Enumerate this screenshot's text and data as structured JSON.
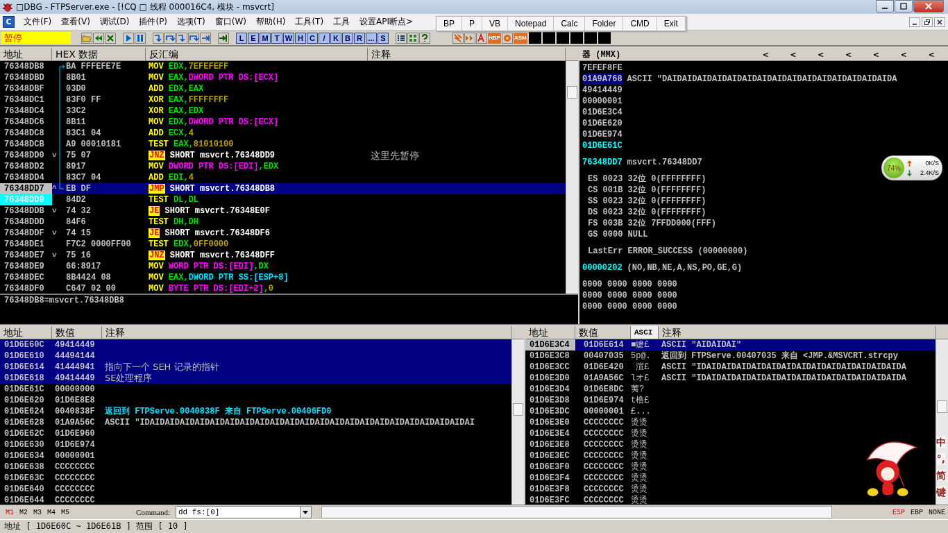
{
  "window": {
    "title": "□DBG - FTPServer.exe - [!CQ □ 线程  000016C4, 模块 - msvcrt]"
  },
  "menu": {
    "app_icon_letter": "C",
    "items": [
      "文件(F)",
      "查看(V)",
      "调试(D)",
      "插件(P)",
      "选项(T)",
      "窗口(W)",
      "帮助(H)",
      "工具(T)",
      "工具",
      "设置API断点>"
    ]
  },
  "quick_toolbar": [
    "BP",
    "P",
    "VB",
    "Notepad",
    "Calc",
    "Folder",
    "CMD",
    "Exit"
  ],
  "toolbar": {
    "status": "暂停",
    "letter_buttons": [
      "L",
      "E",
      "M",
      "T",
      "W",
      "H",
      "C",
      "/",
      "K",
      "B",
      "R",
      "...",
      "S"
    ],
    "plugin_labels": [
      "HBP",
      "ASM"
    ]
  },
  "disasm": {
    "columns": [
      "地址",
      "HEX 数据",
      "反汇编",
      "注释"
    ],
    "rows": [
      {
        "address": "76348DB8",
        "mark": "",
        "hex": "BA FFFEFE7E",
        "mnemonic": "MOV",
        "jump": false,
        "operands": [
          {
            "kind": "reg",
            "text": "EDX"
          },
          {
            "kind": "sep",
            "text": ","
          },
          {
            "kind": "imm",
            "text": "7EFEFEFF"
          }
        ],
        "comment": "",
        "in_loop": true,
        "selected": false,
        "current": false
      },
      {
        "address": "76348DBD",
        "mark": "",
        "hex": "8B01",
        "mnemonic": "MOV",
        "jump": false,
        "operands": [
          {
            "kind": "reg",
            "text": "EAX"
          },
          {
            "kind": "sep",
            "text": ","
          },
          {
            "kind": "mem",
            "text": "DWORD PTR DS:[ECX]"
          }
        ],
        "comment": "",
        "in_loop": true,
        "selected": false,
        "current": false
      },
      {
        "address": "76348DBF",
        "mark": "",
        "hex": "03D0",
        "mnemonic": "ADD",
        "jump": false,
        "operands": [
          {
            "kind": "reg",
            "text": "EDX"
          },
          {
            "kind": "sep",
            "text": ","
          },
          {
            "kind": "reg",
            "text": "EAX"
          }
        ],
        "comment": "",
        "in_loop": true,
        "selected": false,
        "current": false
      },
      {
        "address": "76348DC1",
        "mark": "",
        "hex": "83F0 FF",
        "mnemonic": "XOR",
        "jump": false,
        "operands": [
          {
            "kind": "reg",
            "text": "EAX"
          },
          {
            "kind": "sep",
            "text": ","
          },
          {
            "kind": "imm",
            "text": "FFFFFFFF"
          }
        ],
        "comment": "",
        "in_loop": true,
        "selected": false,
        "current": false
      },
      {
        "address": "76348DC4",
        "mark": "",
        "hex": "33C2",
        "mnemonic": "XOR",
        "jump": false,
        "operands": [
          {
            "kind": "reg",
            "text": "EAX"
          },
          {
            "kind": "sep",
            "text": ","
          },
          {
            "kind": "reg",
            "text": "EDX"
          }
        ],
        "comment": "",
        "in_loop": true,
        "selected": false,
        "current": false
      },
      {
        "address": "76348DC6",
        "mark": "",
        "hex": "8B11",
        "mnemonic": "MOV",
        "jump": false,
        "operands": [
          {
            "kind": "reg",
            "text": "EDX"
          },
          {
            "kind": "sep",
            "text": ","
          },
          {
            "kind": "mem",
            "text": "DWORD PTR DS:[ECX]"
          }
        ],
        "comment": "",
        "in_loop": true,
        "selected": false,
        "current": false
      },
      {
        "address": "76348DC8",
        "mark": "",
        "hex": "83C1 04",
        "mnemonic": "ADD",
        "jump": false,
        "operands": [
          {
            "kind": "reg",
            "text": "ECX"
          },
          {
            "kind": "sep",
            "text": ","
          },
          {
            "kind": "imm",
            "text": "4"
          }
        ],
        "comment": "",
        "in_loop": true,
        "selected": false,
        "current": false
      },
      {
        "address": "76348DCB",
        "mark": "",
        "hex": "A9 00010181",
        "mnemonic": "TEST",
        "jump": false,
        "operands": [
          {
            "kind": "reg",
            "text": "EAX"
          },
          {
            "kind": "sep",
            "text": ","
          },
          {
            "kind": "imm",
            "text": "81010100"
          }
        ],
        "comment": "",
        "in_loop": true,
        "selected": false,
        "current": false
      },
      {
        "address": "76348DD0",
        "mark": "˅",
        "hex": "75 07",
        "mnemonic": "JNZ",
        "jump": true,
        "operands": [
          {
            "kind": "plain",
            "text": "SHORT msvcrt.76348DD9"
          }
        ],
        "comment": "这里先暂停",
        "in_loop": true,
        "selected": false,
        "current": false
      },
      {
        "address": "76348DD2",
        "mark": "",
        "hex": "8917",
        "mnemonic": "MOV",
        "jump": false,
        "operands": [
          {
            "kind": "mem",
            "text": "DWORD PTR DS:[EDI]"
          },
          {
            "kind": "sep",
            "text": ","
          },
          {
            "kind": "reg",
            "text": "EDX"
          }
        ],
        "comment": "",
        "in_loop": true,
        "selected": false,
        "current": false
      },
      {
        "address": "76348DD4",
        "mark": "",
        "hex": "83C7 04",
        "mnemonic": "ADD",
        "jump": false,
        "operands": [
          {
            "kind": "reg",
            "text": "EDI"
          },
          {
            "kind": "sep",
            "text": ","
          },
          {
            "kind": "imm",
            "text": "4"
          }
        ],
        "comment": "",
        "in_loop": true,
        "selected": false,
        "current": false
      },
      {
        "address": "76348DD7",
        "mark": "^",
        "hex": "EB DF",
        "mnemonic": "JMP",
        "jump": true,
        "operands": [
          {
            "kind": "plain",
            "text": "SHORT msvcrt.76348DB8"
          }
        ],
        "comment": "",
        "in_loop": true,
        "selected": true,
        "current": false
      },
      {
        "address": "76348DD9",
        "mark": "",
        "hex": "84D2",
        "mnemonic": "TEST",
        "jump": false,
        "operands": [
          {
            "kind": "reg",
            "text": "DL"
          },
          {
            "kind": "sep",
            "text": ","
          },
          {
            "kind": "reg",
            "text": "DL"
          }
        ],
        "comment": "",
        "in_loop": false,
        "selected": false,
        "current": true
      },
      {
        "address": "76348DDB",
        "mark": "˅",
        "hex": "74 32",
        "mnemonic": "JE",
        "jump": true,
        "operands": [
          {
            "kind": "plain",
            "text": "SHORT msvcrt.76348E0F"
          }
        ],
        "comment": "",
        "in_loop": false,
        "selected": false,
        "current": false
      },
      {
        "address": "76348DDD",
        "mark": "",
        "hex": "84F6",
        "mnemonic": "TEST",
        "jump": false,
        "operands": [
          {
            "kind": "reg",
            "text": "DH"
          },
          {
            "kind": "sep",
            "text": ","
          },
          {
            "kind": "reg",
            "text": "DH"
          }
        ],
        "comment": "",
        "in_loop": false,
        "selected": false,
        "current": false
      },
      {
        "address": "76348DDF",
        "mark": "˅",
        "hex": "74 15",
        "mnemonic": "JE",
        "jump": true,
        "operands": [
          {
            "kind": "plain",
            "text": "SHORT msvcrt.76348DF6"
          }
        ],
        "comment": "",
        "in_loop": false,
        "selected": false,
        "current": false
      },
      {
        "address": "76348DE1",
        "mark": "",
        "hex": "F7C2 0000FF00",
        "mnemonic": "TEST",
        "jump": false,
        "operands": [
          {
            "kind": "reg",
            "text": "EDX"
          },
          {
            "kind": "sep",
            "text": ","
          },
          {
            "kind": "imm",
            "text": "0FF0000"
          }
        ],
        "comment": "",
        "in_loop": false,
        "selected": false,
        "current": false
      },
      {
        "address": "76348DE7",
        "mark": "˅",
        "hex": "75 16",
        "mnemonic": "JNZ",
        "jump": true,
        "operands": [
          {
            "kind": "plain",
            "text": "SHORT msvcrt.76348DFF"
          }
        ],
        "comment": "",
        "in_loop": false,
        "selected": false,
        "current": false
      },
      {
        "address": "76348DE9",
        "mark": "",
        "hex": "66:8917",
        "mnemonic": "MOV",
        "jump": false,
        "operands": [
          {
            "kind": "mem",
            "text": "WORD PTR DS:[EDI]"
          },
          {
            "kind": "sep",
            "text": ","
          },
          {
            "kind": "reg",
            "text": "DX"
          }
        ],
        "comment": "",
        "in_loop": false,
        "selected": false,
        "current": false
      },
      {
        "address": "76348DEC",
        "mark": "",
        "hex": "8B4424 08",
        "mnemonic": "MOV",
        "jump": false,
        "operands": [
          {
            "kind": "reg",
            "text": "EAX"
          },
          {
            "kind": "sep",
            "text": ","
          },
          {
            "kind": "stack",
            "text": "DWORD PTR SS:[ESP+8]"
          }
        ],
        "comment": "",
        "in_loop": false,
        "selected": false,
        "current": false
      },
      {
        "address": "76348DF0",
        "mark": "",
        "hex": "C647 02 00",
        "mnemonic": "MOV",
        "jump": false,
        "operands": [
          {
            "kind": "mem",
            "text": "BYTE PTR DS:[EDI+2]"
          },
          {
            "kind": "sep",
            "text": ","
          },
          {
            "kind": "imm",
            "text": "0"
          }
        ],
        "comment": "",
        "in_loop": false,
        "selected": false,
        "current": false
      }
    ],
    "info": "76348DB8=msvcrt.76348DB8"
  },
  "registers": {
    "header": "器 (MMX)",
    "nav_arrows": [
      "<",
      "<",
      "<",
      "<",
      "<",
      "<",
      "<"
    ],
    "groups": [
      {
        "lines": [
          {
            "text": "7EFEF8FE",
            "kind": "plain"
          },
          {
            "text": "01A9A768",
            "kind": "selected",
            "comment": "ASCII \"DAIDAIDAIDAIDAIDAIDAIDAIDAIDAIDAIDAIDAIDAIDAIDA"
          },
          {
            "text": "49414449",
            "kind": "plain"
          },
          {
            "text": "00000001",
            "kind": "plain"
          },
          {
            "text": "01D6E3C4",
            "kind": "plain"
          },
          {
            "text": "01D6E620",
            "kind": "plain"
          },
          {
            "text": "01D6E974",
            "kind": "plain"
          },
          {
            "text": "01D6E61C",
            "kind": "changed"
          }
        ]
      },
      {
        "lines": [
          {
            "text": "76348DD7",
            "kind": "changed",
            "comment": "msvcrt.76348DD7"
          }
        ]
      },
      {
        "lines": [
          {
            "text": "ES 0023 32位 0(FFFFFFFF)",
            "kind": "segment"
          },
          {
            "text": "CS 001B 32位 0(FFFFFFFF)",
            "kind": "segment"
          },
          {
            "text": "SS 0023 32位 0(FFFFFFFF)",
            "kind": "segment"
          },
          {
            "text": "DS 0023 32位 0(FFFFFFFF)",
            "kind": "segment"
          },
          {
            "text": "FS 003B 32位 7FFDD000(FFF)",
            "kind": "segment"
          },
          {
            "text": "GS 0000 NULL",
            "kind": "segment"
          }
        ]
      },
      {
        "lines": [
          {
            "text": "LastErr ERROR_SUCCESS (00000000)",
            "kind": "segment"
          }
        ]
      },
      {
        "lines": [
          {
            "text": "00000202",
            "kind": "changed",
            "comment": "(NO,NB,NE,A,NS,PO,GE,G)"
          }
        ]
      },
      {
        "lines": [
          {
            "text": "0000 0000 0000 0000",
            "kind": "plain"
          },
          {
            "text": "0000 0000 0000 0000",
            "kind": "plain"
          },
          {
            "text": "0000 0000 0000 0000",
            "kind": "plain"
          }
        ]
      }
    ]
  },
  "net_widget": {
    "percent": "74%",
    "upload": "0K/S",
    "download": "2.4K/S"
  },
  "dump": {
    "columns": [
      "地址",
      "数值",
      "注释"
    ],
    "rows": [
      {
        "address": "01D6E60C",
        "value": "49414449",
        "selected": true
      },
      {
        "address": "01D6E610",
        "value": "44494144",
        "selected": true
      },
      {
        "address": "01D6E614",
        "value": "41444941",
        "comment": "指向下一个 SEH 记录的指针",
        "kind": "plain",
        "selected": true
      },
      {
        "address": "01D6E618",
        "value": "49414449",
        "comment": "SE处理程序",
        "kind": "plain",
        "selected": true
      },
      {
        "address": "01D6E61C",
        "value": "00000000",
        "selected": false
      },
      {
        "address": "01D6E620",
        "value": "01D6E8E8",
        "selected": false
      },
      {
        "address": "01D6E624",
        "value": "0040838F",
        "comment": "返回到 FTPServe.0040838F 来自 FTPServe.00406FD0",
        "kind": "return",
        "selected": false
      },
      {
        "address": "01D6E628",
        "value": "01A9A56C",
        "comment": "ASCII \"IDAIDAIDAIDAIDAIDAIDAIDAIDAIDAIDAIDAIDAIDAIDAIDAIDAIDAIDAIDAIDAIDAI",
        "kind": "plain",
        "selected": false
      },
      {
        "address": "01D6E62C",
        "value": "01D6E960",
        "selected": false
      },
      {
        "address": "01D6E630",
        "value": "01D6E974",
        "selected": false
      },
      {
        "address": "01D6E634",
        "value": "00000001",
        "selected": false
      },
      {
        "address": "01D6E638",
        "value": "CCCCCCCC",
        "selected": false
      },
      {
        "address": "01D6E63C",
        "value": "CCCCCCCC",
        "selected": false
      },
      {
        "address": "01D6E640",
        "value": "CCCCCCCC",
        "selected": false
      },
      {
        "address": "01D6E644",
        "value": "CCCCCCCC",
        "selected": false
      }
    ]
  },
  "stack": {
    "columns": [
      "地址",
      "数值",
      "ASCI",
      "注释"
    ],
    "rows": [
      {
        "address": "01D6E3C4",
        "value": "01D6E614",
        "ascii": "■嬷£",
        "comment": "ASCII \"AIDAIDAI\"",
        "selected": true
      },
      {
        "address": "01D6E3C8",
        "value": "00407035",
        "ascii": "5p@.",
        "comment": "返回到 FTPServe.00407035 来自 <JMP.&MSVCRT.strcpy",
        "selected": false
      },
      {
        "address": "01D6E3CC",
        "value": "01D6E420",
        "ascii": " 渲£",
        "comment": "ASCII \"IDAIDAIDAIDAIDAIDAIDAIDAIDAIDAIDAIDAIDAIDA",
        "selected": false
      },
      {
        "address": "01D6E3D0",
        "value": "01A9A56C",
        "ascii": "lオ£",
        "comment": "ASCII \"IDAIDAIDAIDAIDAIDAIDAIDAIDAIDAIDAIDAIDAIDA",
        "selected": false
      },
      {
        "address": "01D6E3D4",
        "value": "01D6E8DC",
        "ascii": "荑?",
        "comment": "",
        "selected": false
      },
      {
        "address": "01D6E3D8",
        "value": "01D6E974",
        "ascii": "t橹£",
        "comment": "",
        "selected": false
      },
      {
        "address": "01D6E3DC",
        "value": "00000001",
        "ascii": "£...",
        "comment": "",
        "selected": false
      },
      {
        "address": "01D6E3E0",
        "value": "CCCCCCCC",
        "ascii": "烫烫",
        "comment": "",
        "selected": false
      },
      {
        "address": "01D6E3E4",
        "value": "CCCCCCCC",
        "ascii": "烫烫",
        "comment": "",
        "selected": false
      },
      {
        "address": "01D6E3E8",
        "value": "CCCCCCCC",
        "ascii": "烫烫",
        "comment": "",
        "selected": false
      },
      {
        "address": "01D6E3EC",
        "value": "CCCCCCCC",
        "ascii": "烫烫",
        "comment": "",
        "selected": false
      },
      {
        "address": "01D6E3F0",
        "value": "CCCCCCCC",
        "ascii": "烫烫",
        "comment": "",
        "selected": false
      },
      {
        "address": "01D6E3F4",
        "value": "CCCCCCCC",
        "ascii": "烫烫",
        "comment": "",
        "selected": false
      },
      {
        "address": "01D6E3F8",
        "value": "CCCCCCCC",
        "ascii": "烫烫",
        "comment": "",
        "selected": false
      },
      {
        "address": "01D6E3FC",
        "value": "CCCCCCCC",
        "ascii": "烫烫",
        "comment": "",
        "selected": false
      }
    ]
  },
  "ime": [
    "中",
    "°,",
    "简",
    "键"
  ],
  "command_bar": {
    "dump_tabs": [
      {
        "label": "M1",
        "selected": true
      },
      {
        "label": "M2",
        "selected": false
      },
      {
        "label": "M3",
        "selected": false
      },
      {
        "label": "M4",
        "selected": false
      },
      {
        "label": "M5",
        "selected": false
      }
    ],
    "command_label": "Command:",
    "command_value": "dd fs:[0]",
    "stack_modes": [
      {
        "label": "ESP",
        "selected": true
      },
      {
        "label": "EBP",
        "selected": false
      },
      {
        "label": "NONE",
        "selected": false
      }
    ]
  },
  "status_bar": "地址 [ 1D6E60C ~ 1D6E61B ] 范围 [ 10 ]"
}
